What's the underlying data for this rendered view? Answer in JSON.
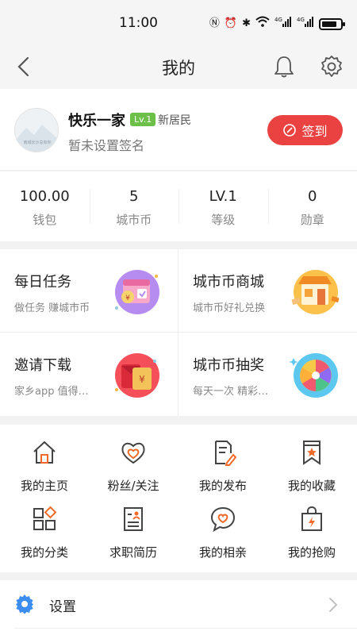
{
  "status_bar": {
    "time": "11:00",
    "network_labels": [
      "4G",
      "4G"
    ]
  },
  "nav": {
    "title": "我的"
  },
  "profile": {
    "avatar_caption": "南城长沙总有你",
    "username": "快乐一家",
    "level_badge": "Lv.1",
    "resident_tag": "新居民",
    "signature": "暂未设置签名",
    "signin_label": "签到"
  },
  "stats": [
    {
      "value": "100.00",
      "label": "钱包"
    },
    {
      "value": "5",
      "label": "城市币"
    },
    {
      "value": "LV.1",
      "label": "等级"
    },
    {
      "value": "0",
      "label": "勋章"
    }
  ],
  "tasks": [
    {
      "title": "每日任务",
      "subtitle": "做任务 赚城市币",
      "icon": "calendar-coin-icon"
    },
    {
      "title": "城市币商城",
      "subtitle": "城市币好礼兑换",
      "icon": "shop-icon"
    },
    {
      "title": "邀请下载",
      "subtitle": "家乡app 值得…",
      "icon": "red-envelope-icon"
    },
    {
      "title": "城市币抽奖",
      "subtitle": "每天一次 精彩…",
      "icon": "prize-wheel-icon"
    }
  ],
  "grid": [
    {
      "label": "我的主页",
      "icon": "home-icon"
    },
    {
      "label": "粉丝/关注",
      "icon": "heart-icon"
    },
    {
      "label": "我的发布",
      "icon": "edit-doc-icon"
    },
    {
      "label": "我的收藏",
      "icon": "bookmark-star-icon"
    },
    {
      "label": "我的分类",
      "icon": "category-icon"
    },
    {
      "label": "求职简历",
      "icon": "resume-icon"
    },
    {
      "label": "我的相亲",
      "icon": "chat-heart-icon"
    },
    {
      "label": "我的抢购",
      "icon": "shopping-bag-icon"
    }
  ],
  "settings": {
    "label": "设置",
    "icon": "gear-icon"
  },
  "colors": {
    "accent_red": "#ea4141",
    "icon_orange": "#f06b2a",
    "level_green": "#6cc04a"
  }
}
